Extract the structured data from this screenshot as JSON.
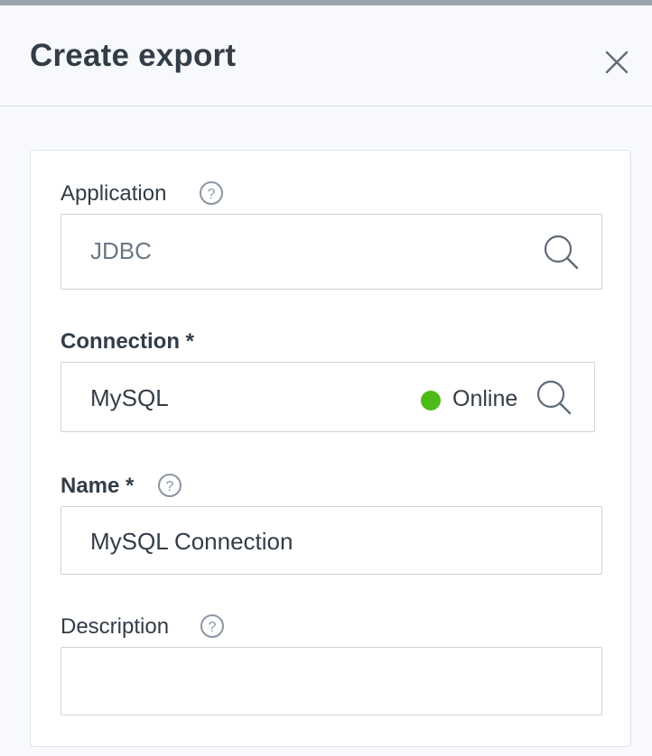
{
  "dialog": {
    "title": "Create export"
  },
  "form": {
    "application": {
      "label": "Application",
      "value": "JDBC"
    },
    "connection": {
      "label": "Connection *",
      "value": "MySQL",
      "status": "Online",
      "status_color": "#4cbb17"
    },
    "name": {
      "label": "Name *",
      "value": "MySQL Connection"
    },
    "description": {
      "label": "Description",
      "value": ""
    }
  },
  "icons": {
    "close": "close-icon",
    "help": "question-circle-icon",
    "search": "search-icon"
  }
}
